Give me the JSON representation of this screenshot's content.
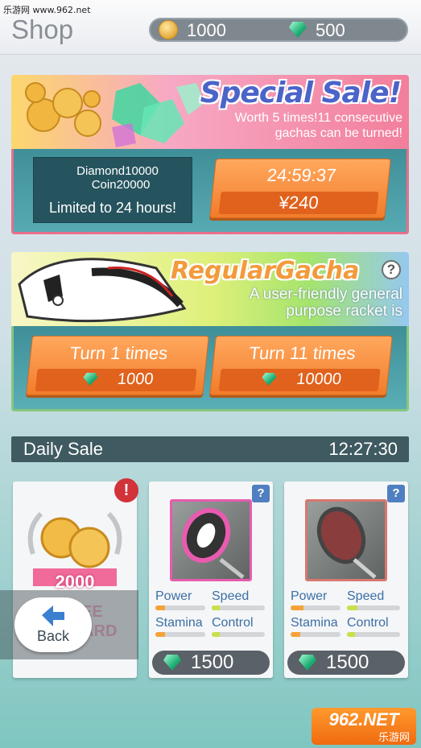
{
  "watermark": "乐游网 www.962.net",
  "header": {
    "title": "Shop",
    "coins": "1000",
    "diamonds": "500"
  },
  "special_sale": {
    "title": "Special Sale!",
    "description": "Worth 5 times!11 consecutive gachas can be turned!",
    "diamond_line": "Diamond10000",
    "coin_line": "Coin20000",
    "limit_text": "Limited to 24 hours!",
    "timer": "24:59:37",
    "price": "¥240"
  },
  "regular_gacha": {
    "title": "RegularGacha",
    "help": "?",
    "description": "A user-friendly general purpose racket is",
    "buttons": [
      {
        "label": "Turn 1 times",
        "cost": "1000"
      },
      {
        "label": "Turn 11 times",
        "cost": "10000"
      }
    ]
  },
  "daily_sale": {
    "label": "Daily Sale",
    "timer": "12:27:30",
    "reward_card": {
      "amount": "2000",
      "alert": "!",
      "ribbon": "FREE REWARD"
    },
    "cards": [
      {
        "help": "?",
        "stats": [
          {
            "name": "Power",
            "level": 0.2
          },
          {
            "name": "Speed",
            "level": 0.15
          },
          {
            "name": "Stamina",
            "level": 0.2
          },
          {
            "name": "Control",
            "level": 0.15
          }
        ],
        "price": "1500",
        "frame_color": "#e85bb0"
      },
      {
        "help": "?",
        "stats": [
          {
            "name": "Power",
            "level": 0.25
          },
          {
            "name": "Speed",
            "level": 0.2
          },
          {
            "name": "Stamina",
            "level": 0.2
          },
          {
            "name": "Control",
            "level": 0.15
          }
        ],
        "price": "1500",
        "frame_color": "#d9776f"
      }
    ]
  },
  "back_button": {
    "label": "Back"
  },
  "corner_logo": {
    "text": "962.NET",
    "sub": "乐游网"
  },
  "colors": {
    "accent_orange": "#f27c2a",
    "stat_label": "#3b6fa5",
    "power_fill": "#f6a23a",
    "speed_fill": "#c9e04a",
    "stamina_fill": "#f6a23a",
    "control_fill": "#c9e04a"
  }
}
